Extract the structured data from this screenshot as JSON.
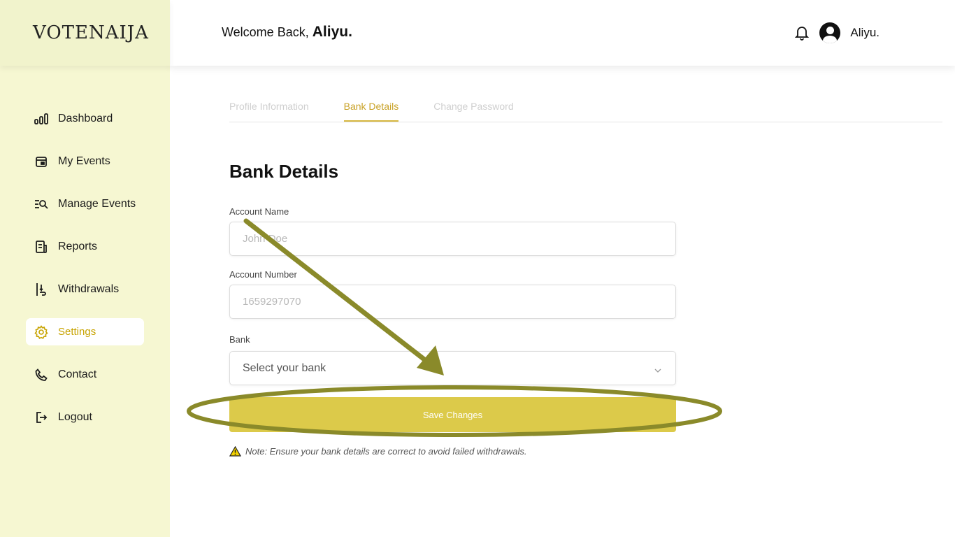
{
  "brand": {
    "name": "VOTENAIJA"
  },
  "header": {
    "welcome_prefix": "Welcome Back,",
    "welcome_name": "Aliyu.",
    "user_name": "Aliyu."
  },
  "sidebar": {
    "items": [
      {
        "label": "Dashboard",
        "icon": "bar-chart-icon"
      },
      {
        "label": "My Events",
        "icon": "calendar-icon"
      },
      {
        "label": "Manage Events",
        "icon": "list-search-icon"
      },
      {
        "label": "Reports",
        "icon": "document-icon"
      },
      {
        "label": "Withdrawals",
        "icon": "withdraw-icon"
      },
      {
        "label": "Settings",
        "icon": "gear-icon",
        "active": true
      },
      {
        "label": "Contact",
        "icon": "phone-icon"
      },
      {
        "label": "Logout",
        "icon": "logout-icon"
      }
    ]
  },
  "tabs": [
    {
      "label": "Profile Information"
    },
    {
      "label": "Bank Details",
      "active": true
    },
    {
      "label": "Change Password"
    }
  ],
  "form": {
    "title": "Bank Details",
    "account_name": {
      "label": "Account Name",
      "placeholder": "John Doe",
      "value": ""
    },
    "account_number": {
      "label": "Account Number",
      "placeholder": "1659297070",
      "value": ""
    },
    "bank": {
      "label": "Bank",
      "selected": "Select your bank"
    },
    "save_label": "Save Changes",
    "note": "Note: Ensure your bank details are correct to avoid failed withdrawals."
  },
  "colors": {
    "sidebar_bg": "#f6f7d2",
    "accent": "#c9a227",
    "button": "#dcca4a",
    "annotation": "#8a8a2a"
  }
}
